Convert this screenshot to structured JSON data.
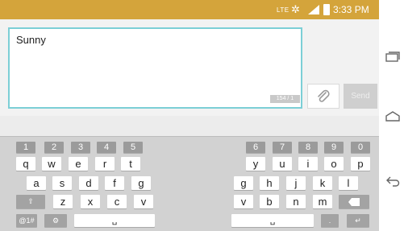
{
  "status_bar": {
    "network": "LTE",
    "time": "3:33 PM"
  },
  "message": {
    "text": "Sunny",
    "char_count": "154 / 1",
    "send_label": "Send"
  },
  "keyboard": {
    "numbers_left": [
      "1",
      "2",
      "3",
      "4",
      "5"
    ],
    "numbers_right": [
      "6",
      "7",
      "8",
      "9",
      "0"
    ],
    "row1_left": [
      "q",
      "w",
      "e",
      "r",
      "t"
    ],
    "row1_right": [
      "y",
      "u",
      "i",
      "o",
      "p"
    ],
    "row2_left": [
      "a",
      "s",
      "d",
      "f",
      "g"
    ],
    "row2_right": [
      "h",
      "j",
      "k",
      "l"
    ],
    "row3_left": [
      "z",
      "x",
      "c",
      "v"
    ],
    "row3_right": [
      "b",
      "n",
      "m"
    ],
    "symbol_key": "@1#"
  },
  "colors": {
    "status_bar": "#d4a43b",
    "input_border": "#7ccfd6",
    "keyboard_bg": "#d2d2d2"
  }
}
